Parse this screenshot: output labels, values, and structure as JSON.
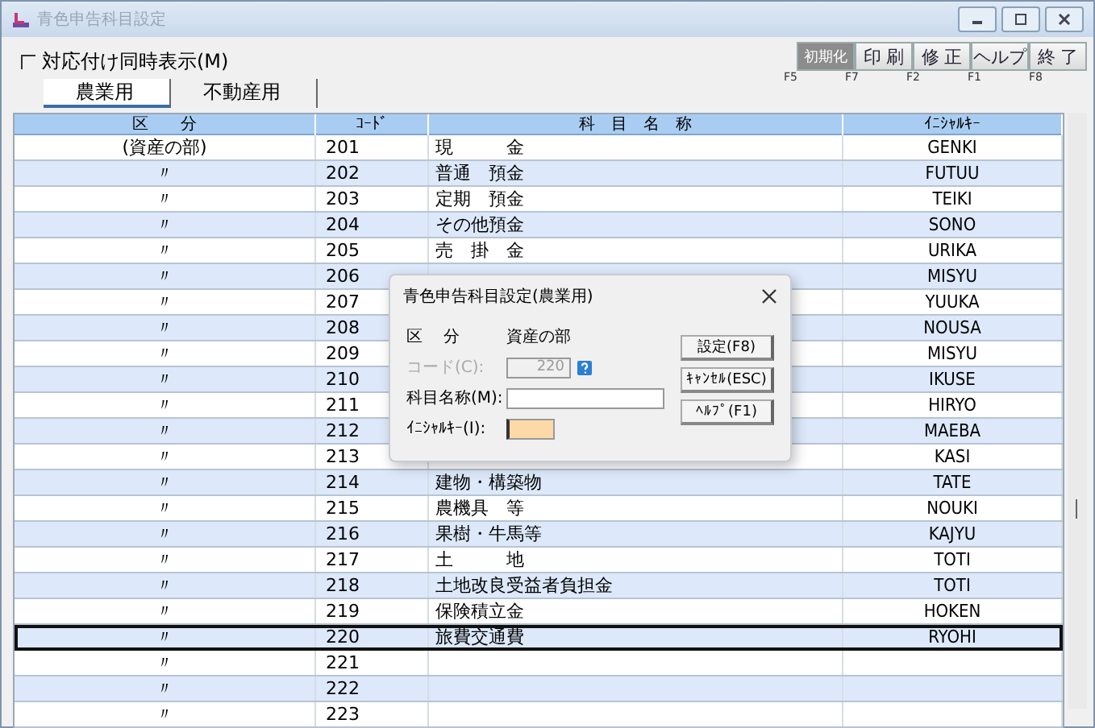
{
  "window": {
    "title": "青色申告科目設定"
  },
  "option": {
    "label": "対応付け同時表示(M)",
    "checked": false
  },
  "tabs": [
    {
      "label": "農業用",
      "selected": true
    },
    {
      "label": "不動産用",
      "selected": false
    }
  ],
  "toolbar": [
    {
      "label": "初期化",
      "key": "F5",
      "disabled": true
    },
    {
      "label": "印 刷",
      "key": "F7",
      "disabled": false
    },
    {
      "label": "修 正",
      "key": "F2",
      "disabled": false
    },
    {
      "label": "ヘルプ",
      "key": "F1",
      "disabled": false
    },
    {
      "label": "終 了",
      "key": "F8",
      "disabled": false
    }
  ],
  "table": {
    "columns": [
      "区　　分",
      "ｺｰﾄﾞ",
      "科　目　名　称",
      "ｲﾆｼｬﾙｷｰ"
    ],
    "rows": [
      {
        "category": "(資産の部)",
        "code": "201",
        "name": "現　　　金",
        "initial": "GENKI",
        "selected": false
      },
      {
        "category": "〃",
        "code": "202",
        "name": "普通　預金",
        "initial": "FUTUU",
        "selected": false
      },
      {
        "category": "〃",
        "code": "203",
        "name": "定期　預金",
        "initial": "TEIKI",
        "selected": false
      },
      {
        "category": "〃",
        "code": "204",
        "name": "その他預金",
        "initial": "SONO",
        "selected": false
      },
      {
        "category": "〃",
        "code": "205",
        "name": "売　掛　金",
        "initial": "URIKA",
        "selected": false
      },
      {
        "category": "〃",
        "code": "206",
        "initial": "MISYU",
        "selected": false
      },
      {
        "category": "〃",
        "code": "207",
        "initial": "YUUKA",
        "selected": false
      },
      {
        "category": "〃",
        "code": "208",
        "initial": "NOUSA",
        "selected": false
      },
      {
        "category": "〃",
        "code": "209",
        "initial": "MISYU",
        "selected": false
      },
      {
        "category": "〃",
        "code": "210",
        "initial": "IKUSE",
        "selected": false
      },
      {
        "category": "〃",
        "code": "211",
        "initial": "HIRYO",
        "selected": false
      },
      {
        "category": "〃",
        "code": "212",
        "initial": "MAEBA",
        "selected": false
      },
      {
        "category": "〃",
        "code": "213",
        "initial": "KASI",
        "selected": false
      },
      {
        "category": "〃",
        "code": "214",
        "name": "建物・構築物",
        "initial": "TATE",
        "selected": false
      },
      {
        "category": "〃",
        "code": "215",
        "name": "農機具　等",
        "initial": "NOUKI",
        "selected": false
      },
      {
        "category": "〃",
        "code": "216",
        "name": "果樹・牛馬等",
        "initial": "KAJYU",
        "selected": false
      },
      {
        "category": "〃",
        "code": "217",
        "name": "土　　　地",
        "initial": "TOTI",
        "selected": false
      },
      {
        "category": "〃",
        "code": "218",
        "name": "土地改良受益者負担金",
        "initial": "TOTI",
        "selected": false
      },
      {
        "category": "〃",
        "code": "219",
        "name": "保険積立金",
        "initial": "HOKEN",
        "selected": false
      },
      {
        "category": "〃",
        "code": "220",
        "name": "旅費交通費",
        "initial": "RYOHI",
        "selected": true
      },
      {
        "category": "〃",
        "code": "221",
        "selected": false
      },
      {
        "category": "〃",
        "code": "222",
        "selected": false
      },
      {
        "category": "〃",
        "code": "223",
        "selected": false
      }
    ]
  },
  "dialog": {
    "title": "青色申告科目設定(農業用)",
    "fields": [
      {
        "kind": "static",
        "label": "区　 分",
        "value": "資産の部"
      },
      {
        "kind": "code",
        "label": "コード(C):",
        "value": "220",
        "disabled": true
      },
      {
        "kind": "text",
        "label": "科目名称(M):",
        "focused": false
      },
      {
        "kind": "text",
        "label": "ｲﾆｼｬﾙｷｰ(I):",
        "focused": true
      }
    ],
    "buttons": [
      "設定(F8)",
      "ｷｬﾝｾﾙ(ESC)",
      "ﾍﾙﾌﾟ(F1)"
    ]
  }
}
